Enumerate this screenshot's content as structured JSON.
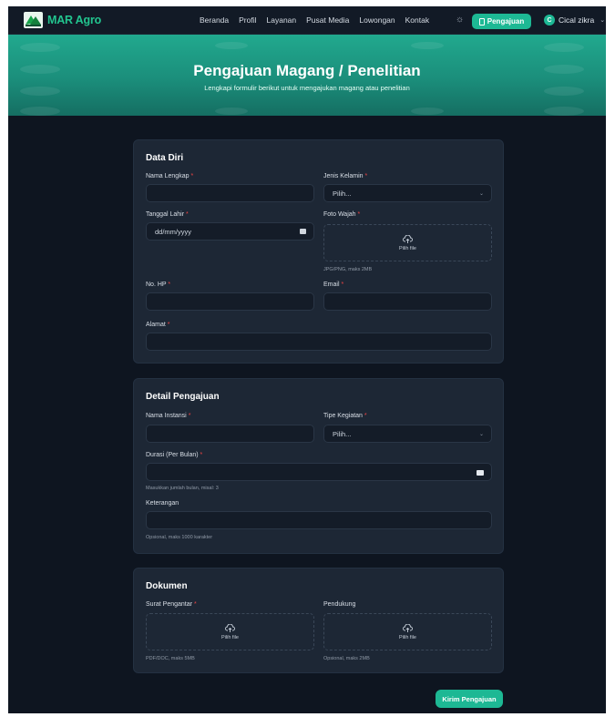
{
  "nav": {
    "brand": "MAR Agro",
    "menu": [
      "Beranda",
      "Profil",
      "Layanan",
      "Pusat Media",
      "Lowongan",
      "Kontak"
    ],
    "action_button": "Pengajuan",
    "user_initial": "C",
    "user_name": "Cical zikra"
  },
  "hero": {
    "title": "Pengajuan Magang / Penelitian",
    "subtitle": "Lengkapi formulir berikut untuk mengajukan magang atau penelitian"
  },
  "data_diri": {
    "title": "Data Diri",
    "nama_label": "Nama Lengkap",
    "jk_label": "Jenis Kelamin",
    "jk_value": "Pilih...",
    "tgl_label": "Tanggal Lahir",
    "tgl_placeholder": "dd/mm/yyyy",
    "foto_label": "Foto Wajah",
    "foto_upload": "Pilih file",
    "foto_hint": "JPG/PNG, maks 2MB",
    "hp_label": "No. HP",
    "email_label": "Email",
    "alamat_label": "Alamat"
  },
  "detail": {
    "title": "Detail Pengajuan",
    "instansi_label": "Nama Instansi",
    "tipe_label": "Tipe Kegiatan",
    "tipe_value": "Pilih...",
    "durasi_label": "Durasi (Per Bulan)",
    "durasi_hint": "Masukkan jumlah bulan, misal: 3",
    "keterangan_label": "Keterangan",
    "keterangan_hint": "Opsional, maks 1000 karakter"
  },
  "dokumen": {
    "title": "Dokumen",
    "surat_label": "Surat Pengantar",
    "surat_upload": "Pilih file",
    "surat_hint": "PDF/DOC, maks 5MB",
    "pendukung_label": "Pendukung",
    "pendukung_upload": "Pilih file",
    "pendukung_hint": "Opsional, maks 2MB"
  },
  "required_mark": "*",
  "submit_label": "Kirim Pengajuan",
  "colors": {
    "accent": "#1db894",
    "page_bg": "#0e1520",
    "card_bg": "#1d2735",
    "brand": "#22c58f"
  }
}
